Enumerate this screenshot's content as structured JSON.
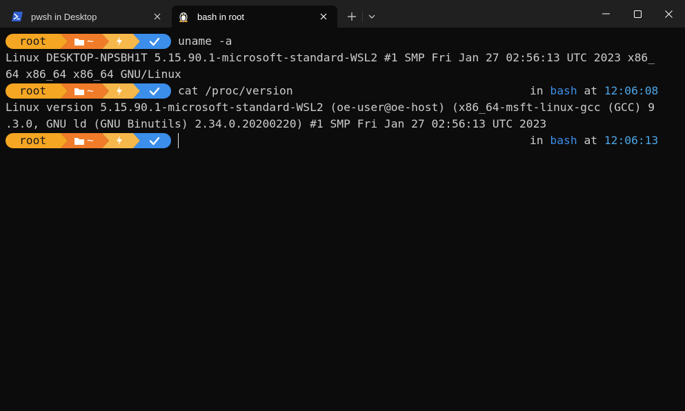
{
  "tabs": [
    {
      "title": "pwsh in Desktop",
      "icon": "powershell-icon",
      "active": false
    },
    {
      "title": "bash in root",
      "icon": "linux-tux-icon",
      "active": true
    }
  ],
  "toolbar": {
    "new_tab": "+",
    "dropdown": "chevron-down-icon"
  },
  "window_controls": [
    "minimize-icon",
    "maximize-icon",
    "close-icon"
  ],
  "colors": {
    "prompt_user_bg": "#f5a623",
    "prompt_path_bg": "#f07c2a",
    "prompt_git_bg": "#f7b84b",
    "prompt_status_bg": "#3b8eea",
    "accent_blue": "#3b8eea",
    "time_blue": "#4ea6e6",
    "text": "#cccccc",
    "background": "#0c0c0c"
  },
  "prompt": {
    "user": "root",
    "path": "~",
    "path_icon": "folder-icon",
    "git_icon": "lightning-icon",
    "status_icon": "checkmark-icon"
  },
  "terminal": {
    "cmd1": "uname -a",
    "out1_line1": "Linux DESKTOP-NPSBH1T 5.15.90.1-microsoft-standard-WSL2 #1 SMP Fri Jan 27 02:56:13 UTC 2023 x86_",
    "out1_line2": "64 x86_64 x86_64 GNU/Linux",
    "cmd2": "cat /proc/version",
    "right2_in": "in",
    "right2_shell": "bash",
    "right2_at": "at",
    "right2_time": "12:06:08",
    "out2_line1": "Linux version 5.15.90.1-microsoft-standard-WSL2 (oe-user@oe-host) (x86_64-msft-linux-gcc (GCC) 9",
    "out2_line2": ".3.0, GNU ld (GNU Binutils) 2.34.0.20200220) #1 SMP Fri Jan 27 02:56:13 UTC 2023",
    "right3_in": "in",
    "right3_shell": "bash",
    "right3_at": "at",
    "right3_time": "12:06:13"
  }
}
